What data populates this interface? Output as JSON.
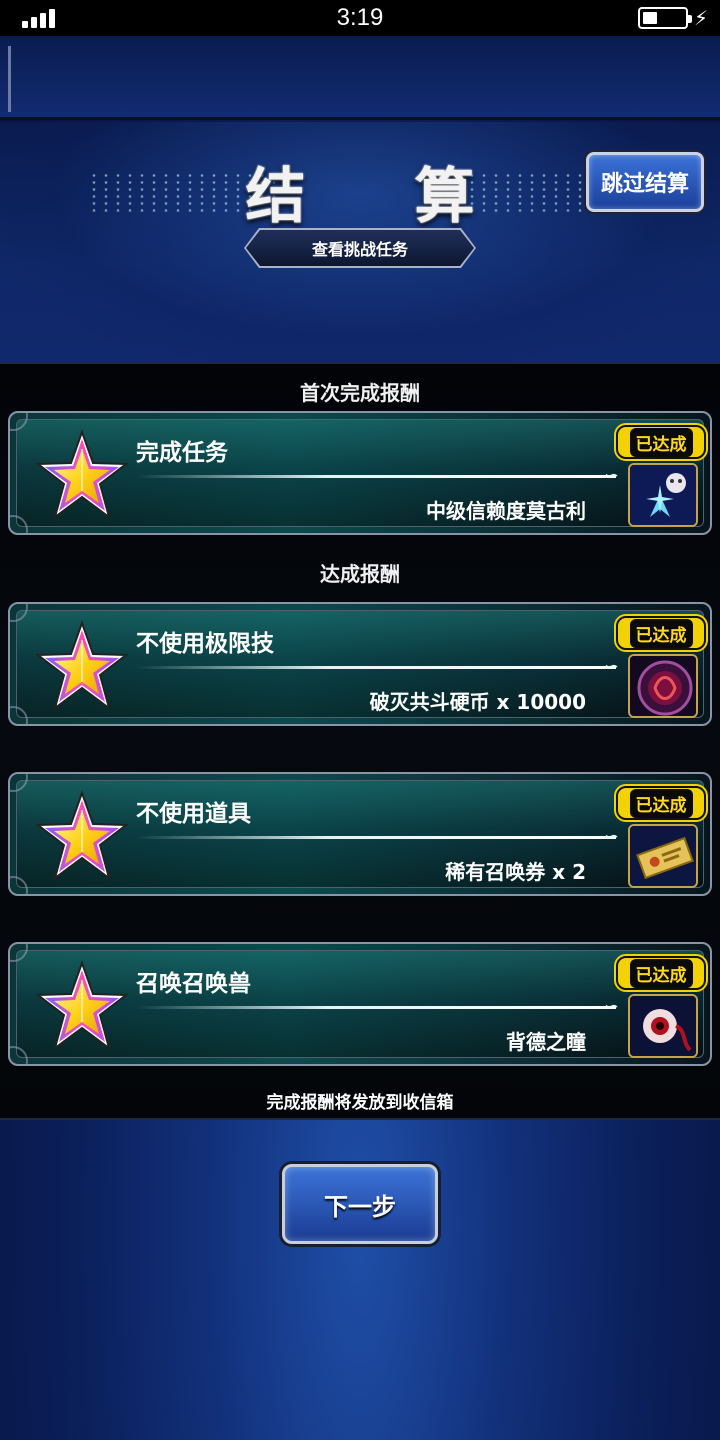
{
  "status_bar": {
    "time": "3:19"
  },
  "header": {
    "title": "结 算",
    "skip_button": "跳过结算",
    "view_task_button": "查看挑战任务"
  },
  "sections": {
    "first_clear_label": "首次完成报酬",
    "achievement_label": "达成报酬",
    "footer_note": "完成报酬将发放到收信箱"
  },
  "tasks": [
    {
      "name": "完成任务",
      "reward": "中级信赖度莫古利",
      "status": "已达成",
      "icon": "moogle-trust-icon"
    },
    {
      "name": "不使用极限技",
      "reward": "破灭共斗硬币 x 10000",
      "status": "已达成",
      "icon": "coin-icon"
    },
    {
      "name": "不使用道具",
      "reward": "稀有召唤券 x 2",
      "status": "已达成",
      "icon": "ticket-icon"
    },
    {
      "name": "召唤召唤兽",
      "reward": "背德之瞳",
      "status": "已达成",
      "icon": "eyeball-icon"
    }
  ],
  "next_button": "下一步",
  "colors": {
    "achieved_badge": "#f2d200",
    "button_blue": "#2a5ac0",
    "card_teal": "#0b4a4c"
  }
}
